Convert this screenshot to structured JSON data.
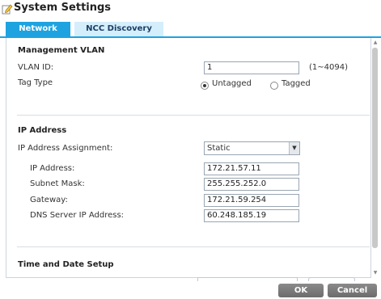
{
  "window": {
    "title": "System Settings"
  },
  "tabs": [
    {
      "label": "Network",
      "active": true
    },
    {
      "label": "NCC Discovery",
      "active": false
    }
  ],
  "management_vlan": {
    "title": "Management VLAN",
    "vlan_id_label": "VLAN ID:",
    "vlan_id_value": "1",
    "vlan_range": "(1~4094)",
    "tag_type_label": "Tag Type",
    "tag_options": [
      {
        "label": "Untagged",
        "selected": true
      },
      {
        "label": "Tagged",
        "selected": false
      }
    ]
  },
  "ip_address": {
    "title": "IP Address",
    "assignment_label": "IP Address Assignment:",
    "assignment_value": "Static",
    "ip_label": "IP Address:",
    "ip_value": "172.21.57.11",
    "mask_label": "Subnet Mask:",
    "mask_value": "255.255.252.0",
    "gateway_label": "Gateway:",
    "gateway_value": "172.21.59.254",
    "dns_label": "DNS Server IP Address:",
    "dns_value": "60.248.185.19"
  },
  "time_date": {
    "title": "Time and Date Setup"
  },
  "buttons": {
    "ok": "OK",
    "cancel": "Cancel"
  },
  "colors": {
    "accent": "#1ea3e0",
    "tab_inactive": "#d4eefb",
    "button": "#7a7a7a"
  }
}
